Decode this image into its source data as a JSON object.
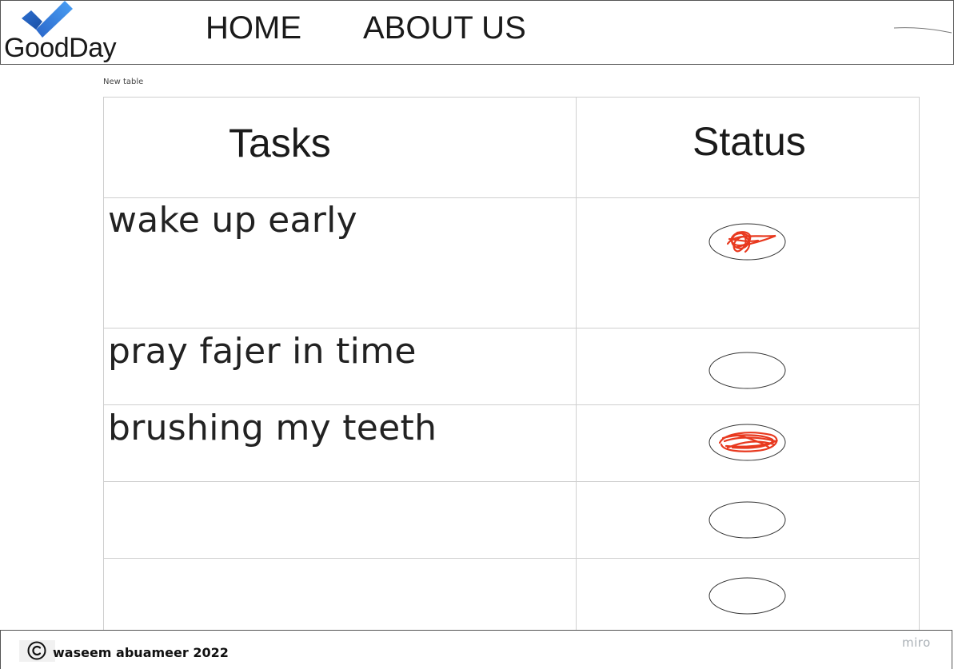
{
  "header": {
    "logo_text": "GoodDay",
    "logo_icon": "checkmark-icon",
    "nav": {
      "home_label": "HOME",
      "about_label": "ABOUT US"
    }
  },
  "table": {
    "label": "New table",
    "headers": {
      "tasks": "Tasks",
      "status": "Status"
    },
    "rows": [
      {
        "task": "wake up early",
        "status": "done"
      },
      {
        "task": "pray fajer in time",
        "status": "empty"
      },
      {
        "task": "brushing my teeth",
        "status": "done"
      },
      {
        "task": "",
        "status": "empty"
      },
      {
        "task": "",
        "status": "empty"
      }
    ]
  },
  "footer": {
    "copyright_icon": "copyright-icon",
    "text": "waseem abuameer 2022"
  },
  "watermark": "miro",
  "colors": {
    "scribble": "#e8391f",
    "logo_blue_dark": "#1f5fb8",
    "logo_blue_light": "#3f8ff0"
  }
}
